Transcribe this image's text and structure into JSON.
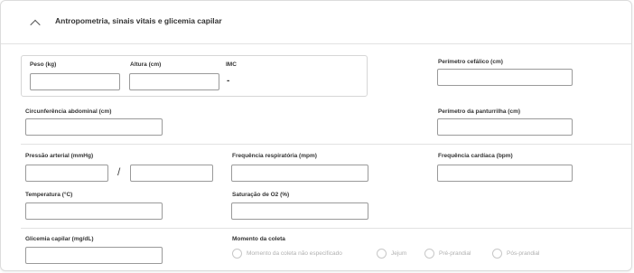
{
  "section": {
    "title": "Antropometria, sinais vitais e glicemia capilar"
  },
  "fields": {
    "peso": "Peso (kg)",
    "altura": "Altura (cm)",
    "imc": "IMC",
    "imc_value": "-",
    "perimetro_cefalico": "Perímetro cefálico (cm)",
    "circunferencia_abdominal": "Circunferência abdominal (cm)",
    "perimetro_panturrilha": "Perímetro da panturrilha (cm)",
    "pressao_arterial": "Pressão arterial (mmHg)",
    "pressao_separator": "/",
    "frequencia_respiratoria": "Frequência respiratória (mpm)",
    "frequencia_cardiaca": "Frequência cardíaca (bpm)",
    "temperatura": "Temperatura (°C)",
    "saturacao": "Saturação de O2 (%)",
    "glicemia": "Glicemia capilar (mg/dL)",
    "momento_coleta": "Momento da coleta"
  },
  "momento_options": [
    "Momento da coleta não especificado",
    "Jejum",
    "Pré-prandial",
    "Pós-prandial"
  ]
}
